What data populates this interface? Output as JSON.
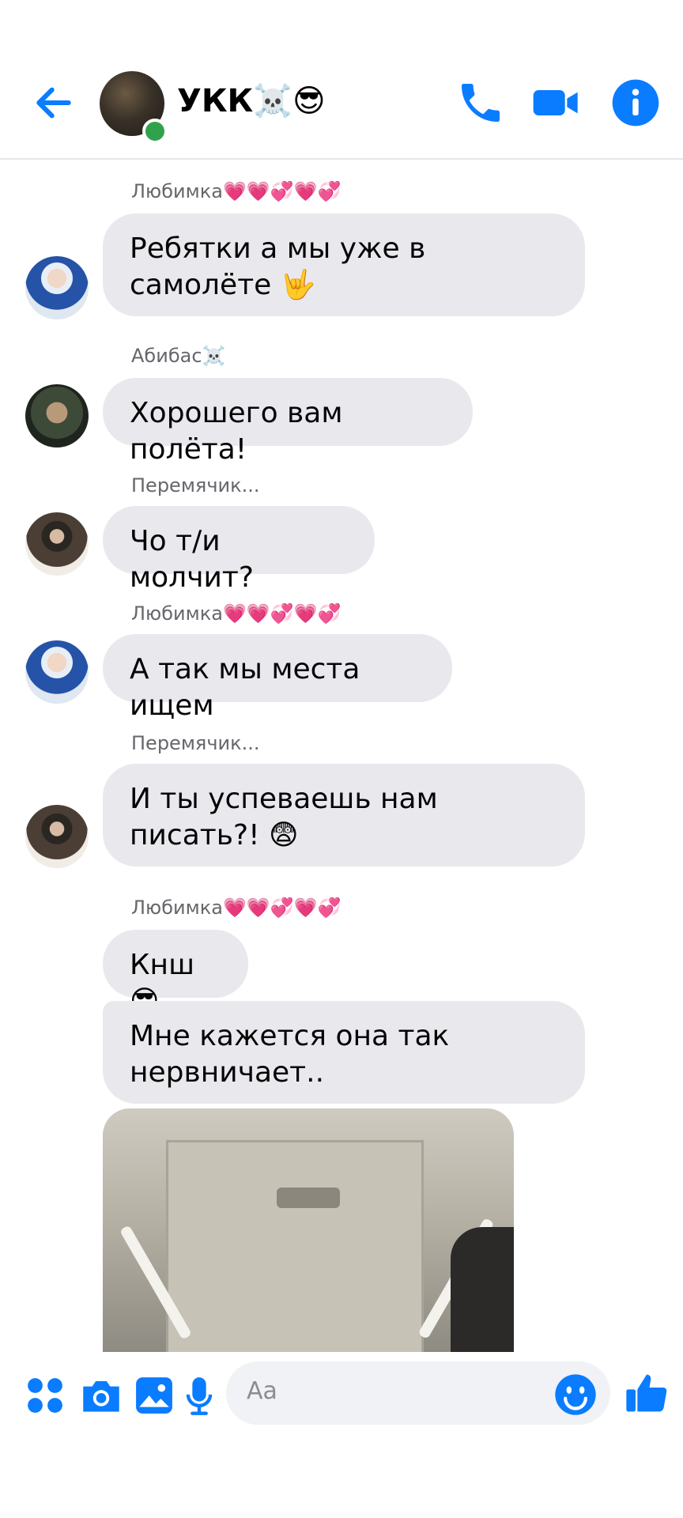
{
  "header": {
    "title": "УКК☠️😎",
    "icons": {
      "back": "back-arrow-icon",
      "call": "phone-icon",
      "video": "video-camera-icon",
      "info": "info-icon"
    },
    "accent": "#0a7cff",
    "online": true
  },
  "messages": [
    {
      "sender": "Любимка💗💗💞💗💞",
      "text": "Ребятки а мы уже в самолёте 🤟"
    },
    {
      "sender": "Абибас☠️",
      "text": "Хорошего вам полёта!"
    },
    {
      "sender": "Перемячик...",
      "text": "Чо т/и молчит?"
    },
    {
      "sender": "Любимка💗💗💞💗💞",
      "text": "А так мы места ищем"
    },
    {
      "sender": "Перемячик...",
      "text": "И ты успеваешь нам писать?! 😨"
    },
    {
      "sender": "Любимка💗💗💞💗💞",
      "text": "Кнш😎"
    },
    {
      "sender": "",
      "text": "Мне кажется она так нервничает.."
    }
  ],
  "composer": {
    "placeholder": "Aa",
    "icons": [
      "apps-grid-icon",
      "camera-icon",
      "image-icon",
      "microphone-icon",
      "emoji-icon",
      "thumbs-up-icon"
    ]
  }
}
